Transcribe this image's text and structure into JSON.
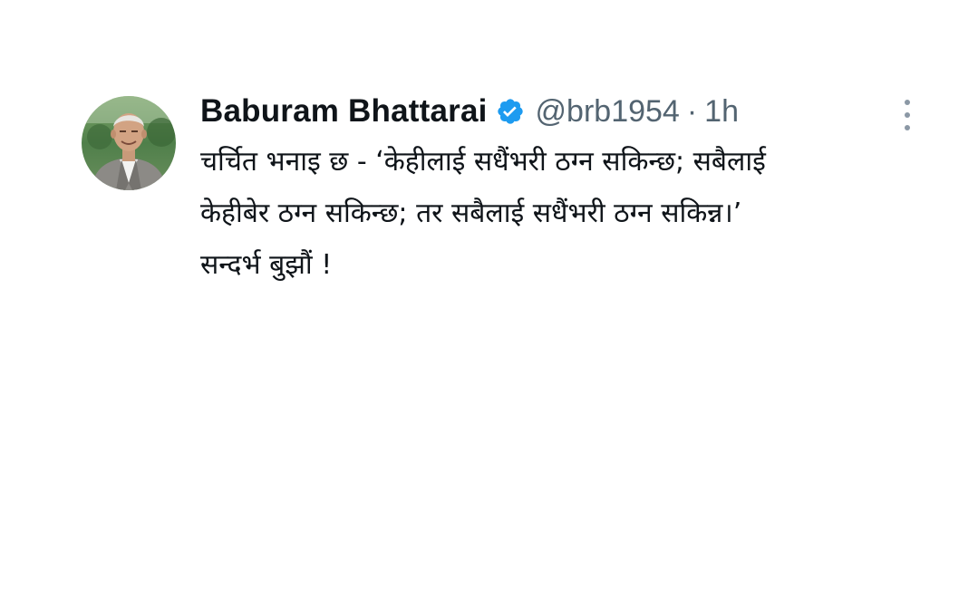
{
  "tweet": {
    "author": {
      "display_name": "Baburam Bhattarai",
      "handle": "@brb1954",
      "verified_icon": "verified-badge-icon",
      "avatar": "avatar"
    },
    "separator": "·",
    "time": "1h",
    "menu_icon": "more-options-icon",
    "text_lines": [
      "चर्चित भनाइ छ - ‘केहीलाई सधैंभरी ठग्न सकिन्छ; सबैलाई",
      "केहीबेर ठग्न सकिन्छ; तर सबैलाई सधैंभरी ठग्न सकिन्न।’",
      "सन्दर्भ बुझौं !"
    ]
  },
  "colors": {
    "text_primary": "#0f1419",
    "text_secondary": "#536471",
    "verified_blue": "#1d9bf0",
    "background": "#ffffff"
  }
}
